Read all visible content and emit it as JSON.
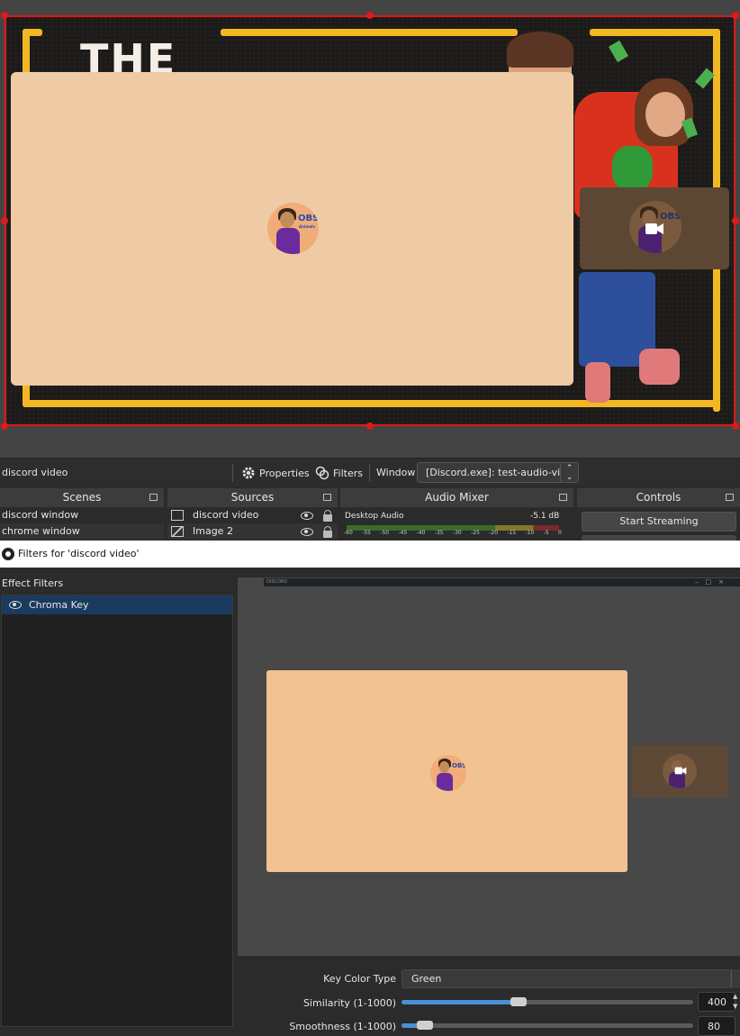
{
  "preview": {
    "overlay_title": "THE",
    "avatar_label": "OBS",
    "avatar_sublabel": "Animals"
  },
  "toolbar": {
    "source_name": "discord video",
    "properties_label": "Properties",
    "filters_label": "Filters",
    "window_label": "Window",
    "window_value": "[Discord.exe]: test-audio-video"
  },
  "docks": {
    "scenes": {
      "title": "Scenes",
      "items": [
        "discord window",
        "chrome window"
      ]
    },
    "sources": {
      "title": "Sources",
      "items": [
        "discord video",
        "Image 2"
      ]
    },
    "mixer": {
      "title": "Audio Mixer",
      "channel": "Desktop Audio",
      "level": "-5.1 dB",
      "ticks": [
        "-60",
        "-55",
        "-50",
        "-45",
        "-40",
        "-35",
        "-30",
        "-25",
        "-20",
        "-15",
        "-10",
        "-5",
        "0"
      ]
    },
    "controls": {
      "title": "Controls",
      "start_streaming": "Start Streaming"
    }
  },
  "filters_dialog": {
    "title": "Filters for 'discord video'",
    "effect_filters_label": "Effect Filters",
    "filters": [
      "Chroma Key"
    ],
    "mini_window_title": "DISCORD",
    "properties": {
      "key_color_type_label": "Key Color Type",
      "key_color_type_value": "Green",
      "similarity_label": "Similarity (1-1000)",
      "similarity_value": "400",
      "similarity_fraction": 0.4,
      "smoothness_label": "Smoothness (1-1000)",
      "smoothness_value": "80",
      "smoothness_fraction": 0.08
    }
  },
  "colors": {
    "selection": "#e0191b",
    "frame_yellow": "#f2b824",
    "discord_tile": "#efcba5",
    "accent_blue": "#4a90d9",
    "selected_row": "#1a3a5e"
  }
}
